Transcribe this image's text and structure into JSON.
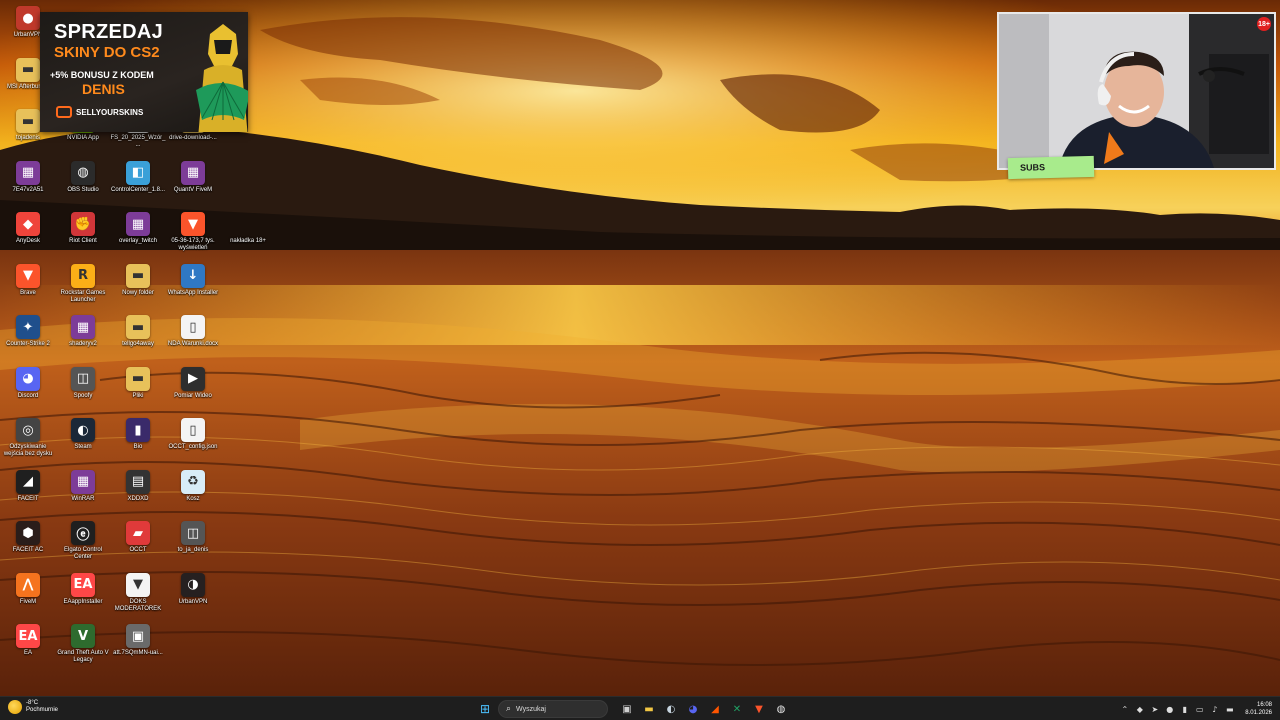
{
  "desktop_icons": [
    {
      "label": "UrbanVPN",
      "kind": "vpn",
      "color": "#c0392b",
      "glyph": "●"
    },
    {
      "label": "MSI Afterburner",
      "kind": "folder",
      "color": "#e8c15a",
      "glyph": "▬"
    },
    {
      "label": "tojadenis",
      "kind": "folder",
      "color": "#e8c15a",
      "glyph": "▬"
    },
    {
      "label": "NVIDIA App",
      "kind": "nvidia",
      "color": "#76b900",
      "glyph": "◉"
    },
    {
      "label": "FS_20_2025_Wzór_...",
      "kind": "document",
      "color": "#f4f4f4",
      "glyph": "▯"
    },
    {
      "label": "drive-download-...",
      "kind": "folder",
      "color": "#e8c15a",
      "glyph": "▬"
    },
    {
      "label": "7E47v2A51",
      "kind": "archive",
      "color": "#7d3c98",
      "glyph": "▦"
    },
    {
      "label": "OBS Studio",
      "kind": "obs",
      "color": "#2b2b2b",
      "glyph": "◍"
    },
    {
      "label": "ControlCenter_1.8...",
      "kind": "installer",
      "color": "#3aa0d8",
      "glyph": "◧"
    },
    {
      "label": "QuantV FiveM",
      "kind": "archive",
      "color": "#7d3c98",
      "glyph": "▦"
    },
    {
      "label": "AnyDesk",
      "kind": "anydesk",
      "color": "#ef443b",
      "glyph": "◆"
    },
    {
      "label": "Riot Client",
      "kind": "riot",
      "color": "#d13639",
      "glyph": "✊"
    },
    {
      "label": "overlay_twitch",
      "kind": "archive",
      "color": "#7d3c98",
      "glyph": "▦"
    },
    {
      "label": "05-36-173,7 tys. wyświetleń",
      "kind": "brave",
      "color": "#fb542b",
      "glyph": "▼"
    },
    {
      "label": "nakładka 18+",
      "kind": "blank",
      "color": "transparent",
      "glyph": ""
    },
    {
      "label": "Brave",
      "kind": "brave",
      "color": "#fb542b",
      "glyph": "▼"
    },
    {
      "label": "Rockstar Games Launcher",
      "kind": "rockstar",
      "color": "#fcaf17",
      "glyph": "R"
    },
    {
      "label": "Nowy folder",
      "kind": "folder",
      "color": "#e8c15a",
      "glyph": "▬"
    },
    {
      "label": "WhatsApp Installer",
      "kind": "download",
      "color": "#2f78c4",
      "glyph": "↓"
    },
    {
      "label": "Counter-Strike 2",
      "kind": "cs2",
      "color": "#1f4f8c",
      "glyph": "✦"
    },
    {
      "label": "shaderyv2",
      "kind": "archive",
      "color": "#7d3c98",
      "glyph": "▦"
    },
    {
      "label": "tellgo4away",
      "kind": "folder",
      "color": "#e8c15a",
      "glyph": "▬"
    },
    {
      "label": "NDA Warunki.docx",
      "kind": "document",
      "color": "#f4f4f4",
      "glyph": "▯"
    },
    {
      "label": "Discord",
      "kind": "discord",
      "color": "#5865f2",
      "glyph": "◕"
    },
    {
      "label": "Spoofy",
      "kind": "app",
      "color": "#555555",
      "glyph": "◫"
    },
    {
      "label": "Pliki",
      "kind": "folder",
      "color": "#e8c15a",
      "glyph": "▬"
    },
    {
      "label": "Pomiar Wideo",
      "kind": "media",
      "color": "#2e2e2e",
      "glyph": "▶"
    },
    {
      "label": "Odzyskiwanie wejścia bez dysku",
      "kind": "app",
      "color": "#444444",
      "glyph": "◎"
    },
    {
      "label": "Steam",
      "kind": "steam",
      "color": "#1b2838",
      "glyph": "◐"
    },
    {
      "label": "Bio",
      "kind": "app",
      "color": "#3a2a6a",
      "glyph": "▮"
    },
    {
      "label": "OCCT_config.json",
      "kind": "document",
      "color": "#f4f4f4",
      "glyph": "▯"
    },
    {
      "label": "FACEIT",
      "kind": "faceit",
      "color": "#1f1f1f",
      "glyph": "◢"
    },
    {
      "label": "WinRAR",
      "kind": "archive",
      "color": "#7d3c98",
      "glyph": "▦"
    },
    {
      "label": "XDDXD",
      "kind": "app",
      "color": "#333333",
      "glyph": "▤"
    },
    {
      "label": "Kosz",
      "kind": "recycle",
      "color": "#d8ecf7",
      "glyph": "♻"
    },
    {
      "label": "FACEIT AC",
      "kind": "faceit-ac",
      "color": "#2a1d1a",
      "glyph": "⬢"
    },
    {
      "label": "Elgato Control Center",
      "kind": "elgato",
      "color": "#1f1f1f",
      "glyph": "ⓔ"
    },
    {
      "label": "OCCT",
      "kind": "occt",
      "color": "#e03a3a",
      "glyph": "▰"
    },
    {
      "label": "to_ja_denis",
      "kind": "app",
      "color": "#555555",
      "glyph": "◫"
    },
    {
      "label": "FiveM",
      "kind": "fivem",
      "color": "#f5731e",
      "glyph": "⋀"
    },
    {
      "label": "EAappInstaller",
      "kind": "ea",
      "color": "#ff4747",
      "glyph": "EA"
    },
    {
      "label": "DOKS MODERATOREK",
      "kind": "brave",
      "color": "#f4f4f4",
      "glyph": "▼"
    },
    {
      "label": "UrbanVPN",
      "kind": "app",
      "color": "#262020",
      "glyph": "◑"
    },
    {
      "label": "EA",
      "kind": "ea",
      "color": "#ff4747",
      "glyph": "EA"
    },
    {
      "label": "Grand Theft Auto V Legacy",
      "kind": "gta",
      "color": "#2e6b2e",
      "glyph": "V"
    },
    {
      "label": "att.7SQmMN-uai...",
      "kind": "image",
      "color": "#6a6a6a",
      "glyph": "▣"
    }
  ],
  "ad_banner": {
    "line1": "SPRZEDAJ",
    "line2": "SKINY DO CS2",
    "line3": "+5% BONUSU Z KODEM",
    "line4": "DENIS",
    "brand": "SELLYOURSKINS",
    "accent": "#ff8a1c"
  },
  "webcam": {
    "badge": "18+",
    "subs_label": "SUBS",
    "subs_color": "#a8eb8c"
  },
  "taskbar": {
    "weather_temp": "-8°C",
    "weather_desc": "Pochmurnie",
    "search_placeholder": "Wyszukaj",
    "pinned": [
      {
        "name": "start-icon",
        "glyph": "⊞",
        "color": "#4cc2ff"
      },
      {
        "name": "task-view-icon",
        "glyph": "▣",
        "color": "#d0d0d0"
      },
      {
        "name": "file-explorer-icon",
        "glyph": "▬",
        "color": "#f2c744"
      },
      {
        "name": "steam-icon",
        "glyph": "◐",
        "color": "#c7d5e0"
      },
      {
        "name": "discord-icon",
        "glyph": "◕",
        "color": "#5865f2"
      },
      {
        "name": "faceit-icon",
        "glyph": "◢",
        "color": "#ff5500"
      },
      {
        "name": "excel-icon",
        "glyph": "✕",
        "color": "#21a366"
      },
      {
        "name": "brave-icon",
        "glyph": "▼",
        "color": "#fb542b"
      },
      {
        "name": "obs-icon",
        "glyph": "◍",
        "color": "#e8e8e8"
      }
    ],
    "time": "16:08",
    "date": "8.01.2026"
  }
}
